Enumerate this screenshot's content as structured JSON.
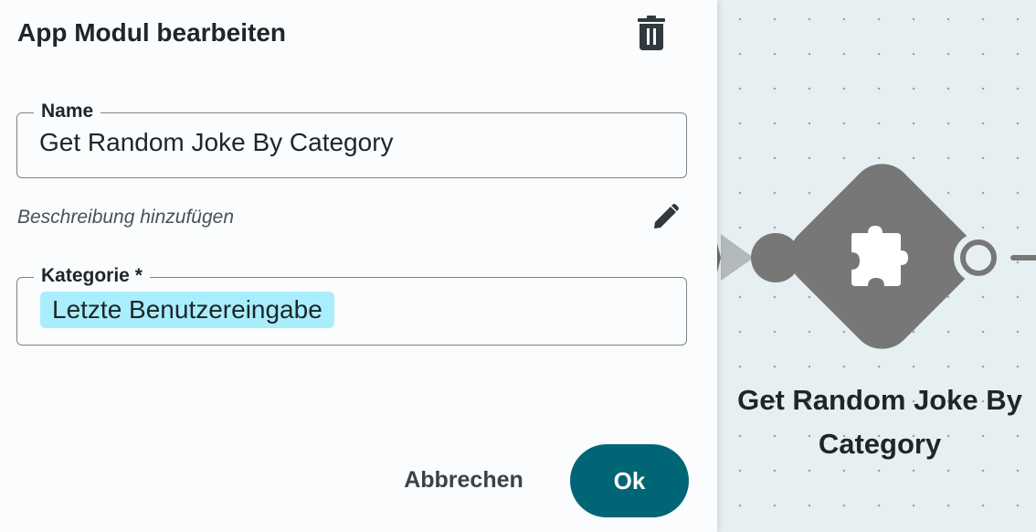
{
  "panel": {
    "title": "App Modul bearbeiten",
    "delete_icon": "trash-icon",
    "name_field": {
      "label": "Name",
      "value": "Get Random Joke By Category"
    },
    "description": {
      "link_text": "Beschreibung hinzufügen",
      "edit_icon": "pencil-icon"
    },
    "category_field": {
      "label": "Kategorie *",
      "selected": "Letzte Benutzereingabe"
    },
    "buttons": {
      "cancel_label": "Abbrechen",
      "ok_label": "Ok"
    }
  },
  "canvas": {
    "node": {
      "label": "Get Random Joke By Category",
      "icon": "puzzle-piece-icon",
      "input_port_icon": "triangle-input-port",
      "output_port_icon": "circle-output-port"
    }
  },
  "colors": {
    "accent": "#006575",
    "chip_background": "#a9eefc",
    "node_fill": "#777777",
    "canvas_background": "#e6f0f2",
    "panel_background": "#fafcfd"
  }
}
